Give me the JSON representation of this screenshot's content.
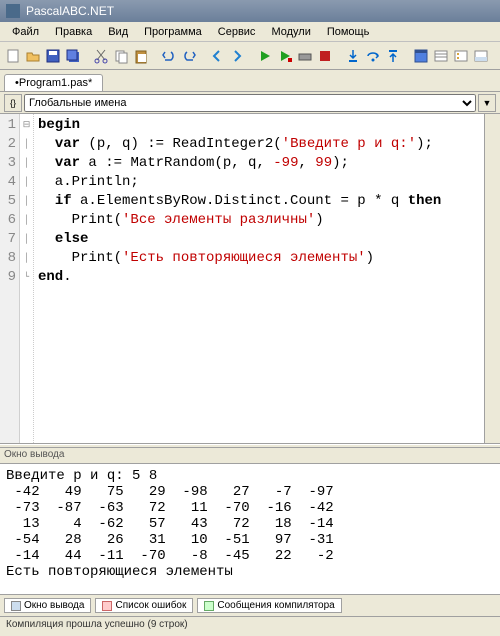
{
  "title": "PascalABC.NET",
  "menu": [
    "Файл",
    "Правка",
    "Вид",
    "Программа",
    "Сервис",
    "Модули",
    "Помощь"
  ],
  "tab": "•Program1.pas*",
  "nav_selected": "Глобальные имена",
  "gutter": [
    "1",
    "2",
    "3",
    "4",
    "5",
    "6",
    "7",
    "8",
    "9"
  ],
  "code": {
    "l1a": "begin",
    "l2a": "  ",
    "l2b": "var",
    "l2c": " (p, q) := ReadInteger2(",
    "l2d": "'Введите p и q:'",
    "l2e": ");",
    "l3a": "  ",
    "l3b": "var",
    "l3c": " a := MatrRandom(p, q, ",
    "l3d": "-99",
    "l3e": ", ",
    "l3f": "99",
    "l3g": ");",
    "l4": "  a.Println;",
    "l5a": "  ",
    "l5b": "if",
    "l5c": " a.ElementsByRow.Distinct.Count = p * q ",
    "l5d": "then",
    "l6a": "    Print(",
    "l6b": "'Все элементы различны'",
    "l6c": ")",
    "l7a": "  ",
    "l7b": "else",
    "l8a": "    Print(",
    "l8b": "'Есть повторяющиеся элементы'",
    "l8c": ")",
    "l9a": "end",
    "l9b": "."
  },
  "output_title": "Окно вывода",
  "output_lines": [
    "Введите p и q: 5 8",
    " -42   49   75   29  -98   27   -7  -97",
    " -73  -87  -63   72   11  -70  -16  -42",
    "  13    4  -62   57   43   72   18  -14",
    " -54   28   26   31   10  -51   97  -31",
    " -14   44  -11  -70   -8  -45   22   -2",
    "Есть повторяющиеся элементы"
  ],
  "bottom_tabs": [
    "Окно вывода",
    "Список ошибок",
    "Сообщения компилятора"
  ],
  "status": "Компиляция прошла успешно (9 строк)"
}
